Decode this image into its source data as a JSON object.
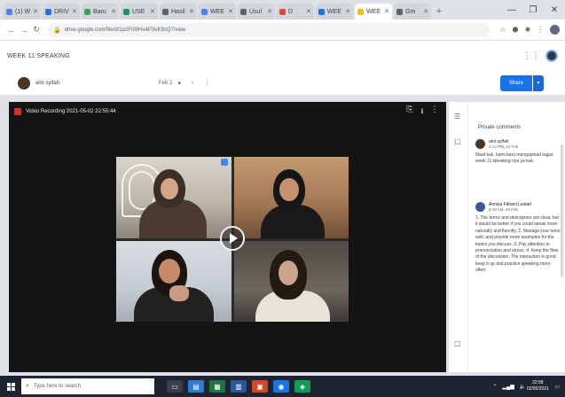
{
  "browser": {
    "tabs": [
      {
        "label": "(1) W",
        "fav": "#4285f4"
      },
      {
        "label": "DRIV",
        "fav": "#1a73e8"
      },
      {
        "label": "Baru",
        "fav": "#34a853"
      },
      {
        "label": "USE",
        "fav": "#0f9d58"
      },
      {
        "label": "Hasil",
        "fav": "#5f6368"
      },
      {
        "label": "WEE",
        "fav": "#4285f4"
      },
      {
        "label": "Usul",
        "fav": "#5f6368"
      },
      {
        "label": "D",
        "fav": "#ea4335"
      },
      {
        "label": "WEE",
        "fav": "#1a73e8"
      },
      {
        "label": "WEE",
        "fav": "#fbbc04",
        "active": true
      },
      {
        "label": "Gm",
        "fav": "#5f6368"
      }
    ],
    "new_tab": "+",
    "url": "drive.google.com/file/d/1p2F0l9Hv4P3eK9sQ7/view"
  },
  "header": {
    "file_title": "WEEK 11 SPEAKING",
    "owner_name": "ami syifah",
    "date": "Feb 2",
    "share_label": "Share"
  },
  "viewer": {
    "recording_title": "Video Recording 2021-05-02 22:55:44"
  },
  "comments": {
    "panel_title": "Private comments",
    "items": [
      {
        "name": "ami syifah",
        "time": "4:12 PM, 24 Feb",
        "text": "Maaf kak, kami baru mengupload tugas week 11 speaking nya ya kak.",
        "avatar": "#4a3527"
      },
      {
        "name": "Annisa Fitriani Lestari",
        "time": "9:18 AM, 25 Feb",
        "text": "1. The terms and descriptors are clear, but it would be better if you could speak more naturally and fluently. 2. Manage your turns well, and provide more examples for the topics you discuss. 3. Pay attention to pronunciation and stress. 4. Keep the flow of the discussion. The interaction is good, keep it up and practice speaking more often.",
        "avatar": "#3b5998"
      }
    ]
  },
  "taskbar": {
    "search_placeholder": "Type here to search",
    "time": "22:58",
    "date": "02/05/2021"
  }
}
